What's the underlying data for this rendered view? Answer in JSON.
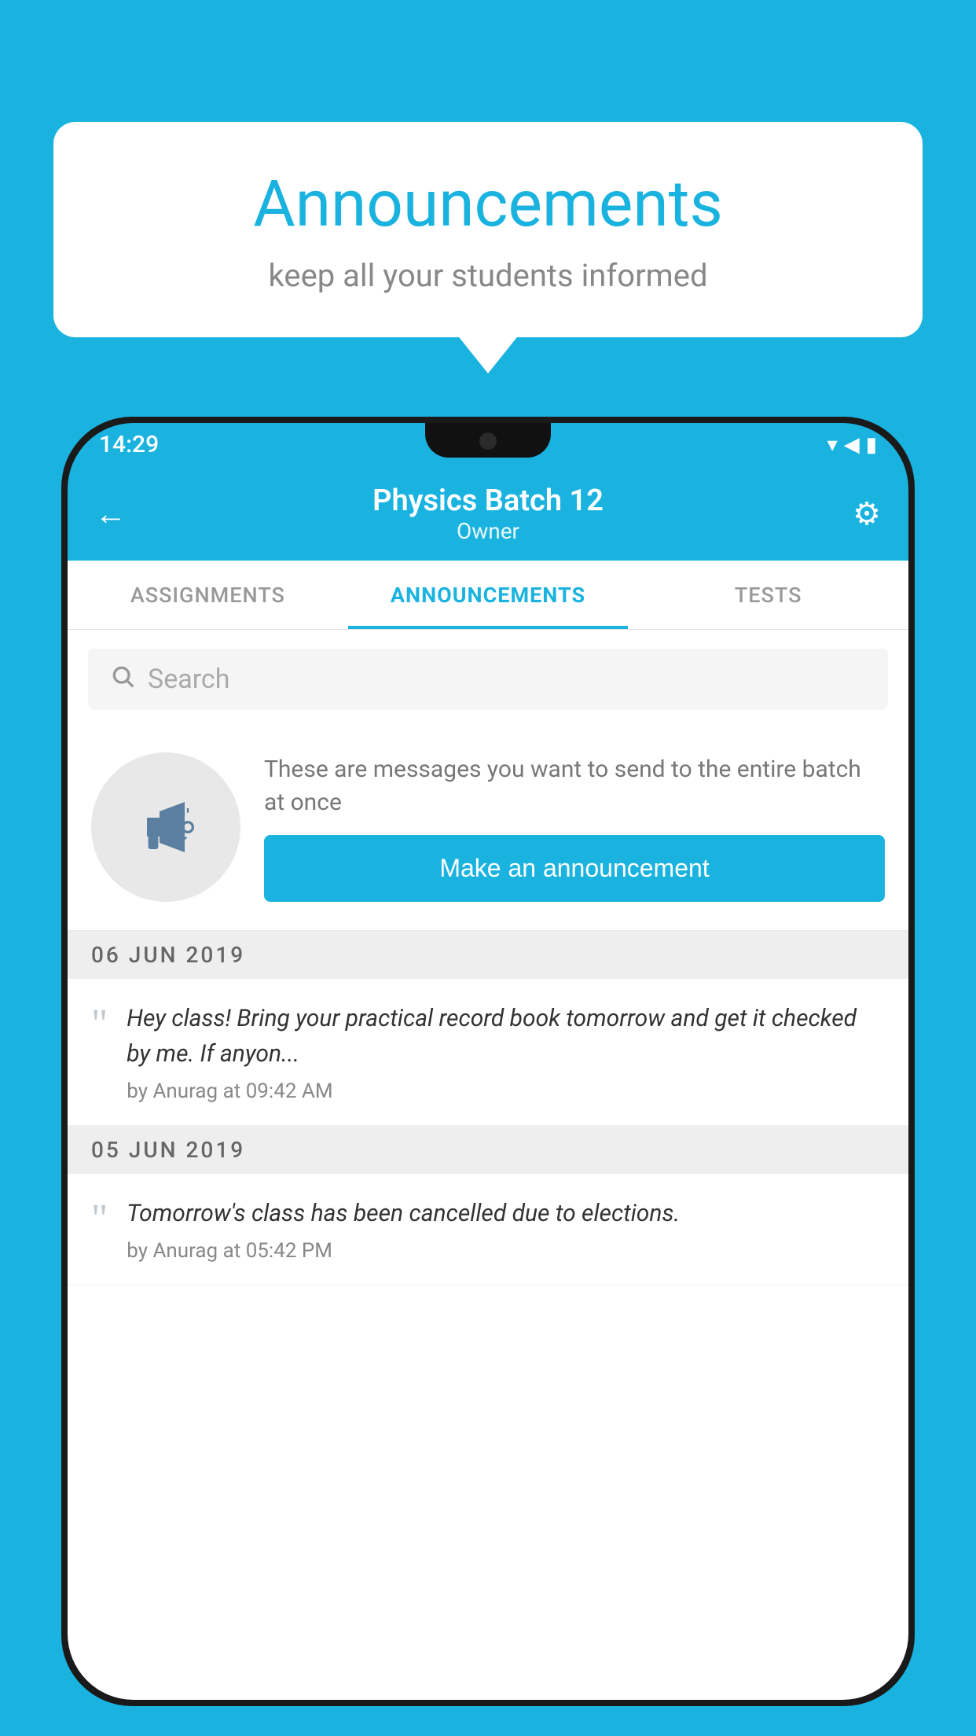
{
  "page": {
    "background_color": "#1ab3e0"
  },
  "speech_bubble": {
    "title": "Announcements",
    "subtitle": "keep all your students informed"
  },
  "phone": {
    "status_bar": {
      "time": "14:29",
      "wifi_icon": "▼",
      "signal_icon": "▲",
      "battery_icon": "▮"
    },
    "header": {
      "back_label": "←",
      "title": "Physics Batch 12",
      "subtitle": "Owner",
      "gear_label": "⚙"
    },
    "tabs": [
      {
        "label": "ASSIGNMENTS",
        "active": false
      },
      {
        "label": "ANNOUNCEMENTS",
        "active": true
      },
      {
        "label": "TESTS",
        "active": false
      }
    ],
    "search": {
      "placeholder": "Search"
    },
    "promo": {
      "description": "These are messages you want to send to the entire batch at once",
      "button_label": "Make an announcement"
    },
    "announcements": [
      {
        "date": "06  JUN  2019",
        "items": [
          {
            "text": "Hey class! Bring your practical record book tomorrow and get it checked by me. If anyon...",
            "meta": "by Anurag at 09:42 AM"
          }
        ]
      },
      {
        "date": "05  JUN  2019",
        "items": [
          {
            "text": "Tomorrow's class has been cancelled due to elections.",
            "meta": "by Anurag at 05:42 PM"
          }
        ]
      }
    ]
  }
}
